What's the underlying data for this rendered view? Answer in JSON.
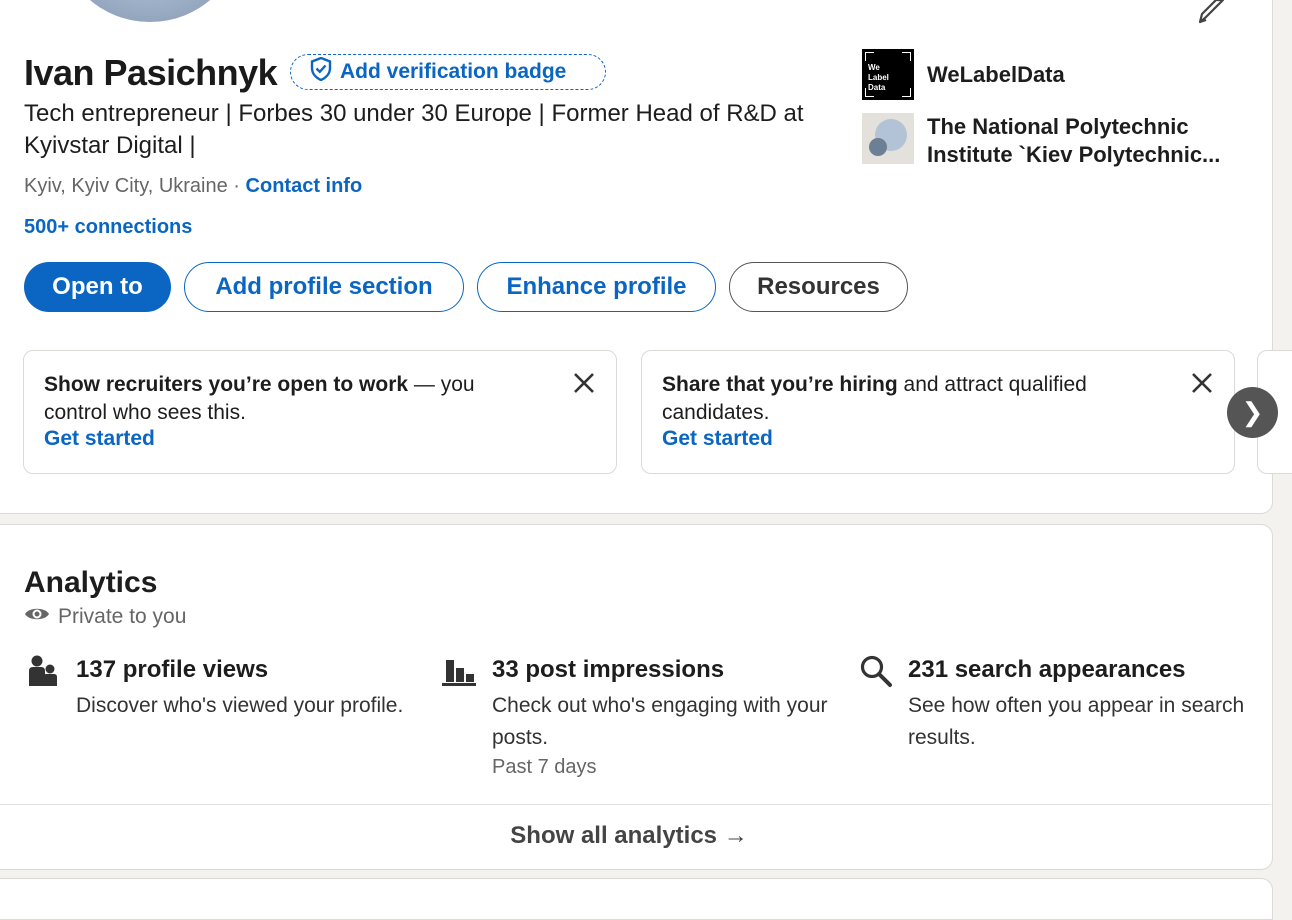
{
  "profile": {
    "name": "Ivan Pasichnyk",
    "verification_badge": "Add verification badge",
    "headline": "Tech entrepreneur | Forbes 30 under 30 Europe | Former Head of R&D at Kyivstar Digital |",
    "location": "Kyiv, Kyiv City, Ukraine",
    "separator": " · ",
    "contact_info": "Contact info",
    "connections": "500+ connections"
  },
  "actions": {
    "open_to": "Open to",
    "add_profile_section": "Add profile section",
    "enhance_profile": "Enhance profile",
    "resources": "Resources"
  },
  "organizations": [
    {
      "name": "WeLabelData",
      "logo_text": [
        "We",
        "Label",
        "Data"
      ]
    },
    {
      "name": "The National Polytechnic Institute `Kiev Polytechnic..."
    }
  ],
  "suggestions": [
    {
      "bold": "Show recruiters you’re open to work",
      "rest": " — you control who sees this.",
      "link": "Get started"
    },
    {
      "bold": "Share that you’re hiring",
      "rest": " and attract qualified candidates.",
      "link": "Get started"
    }
  ],
  "carousel_next": "❯",
  "analytics": {
    "title": "Analytics",
    "privacy": "Private to you",
    "metrics": [
      {
        "title": "137 profile views",
        "description": "Discover who's viewed your profile.",
        "icon": "people-icon"
      },
      {
        "title": "33 post impressions",
        "description": "Check out who's engaging with your posts.",
        "icon": "bar-chart-icon"
      },
      {
        "title": "231 search appearances",
        "description": "See how often you appear in search results.",
        "icon": "search-icon"
      }
    ],
    "period": "Past 7 days",
    "show_all": "Show all analytics →"
  },
  "colors": {
    "accent": "#0a66c2",
    "background": "#f4f2ee"
  }
}
